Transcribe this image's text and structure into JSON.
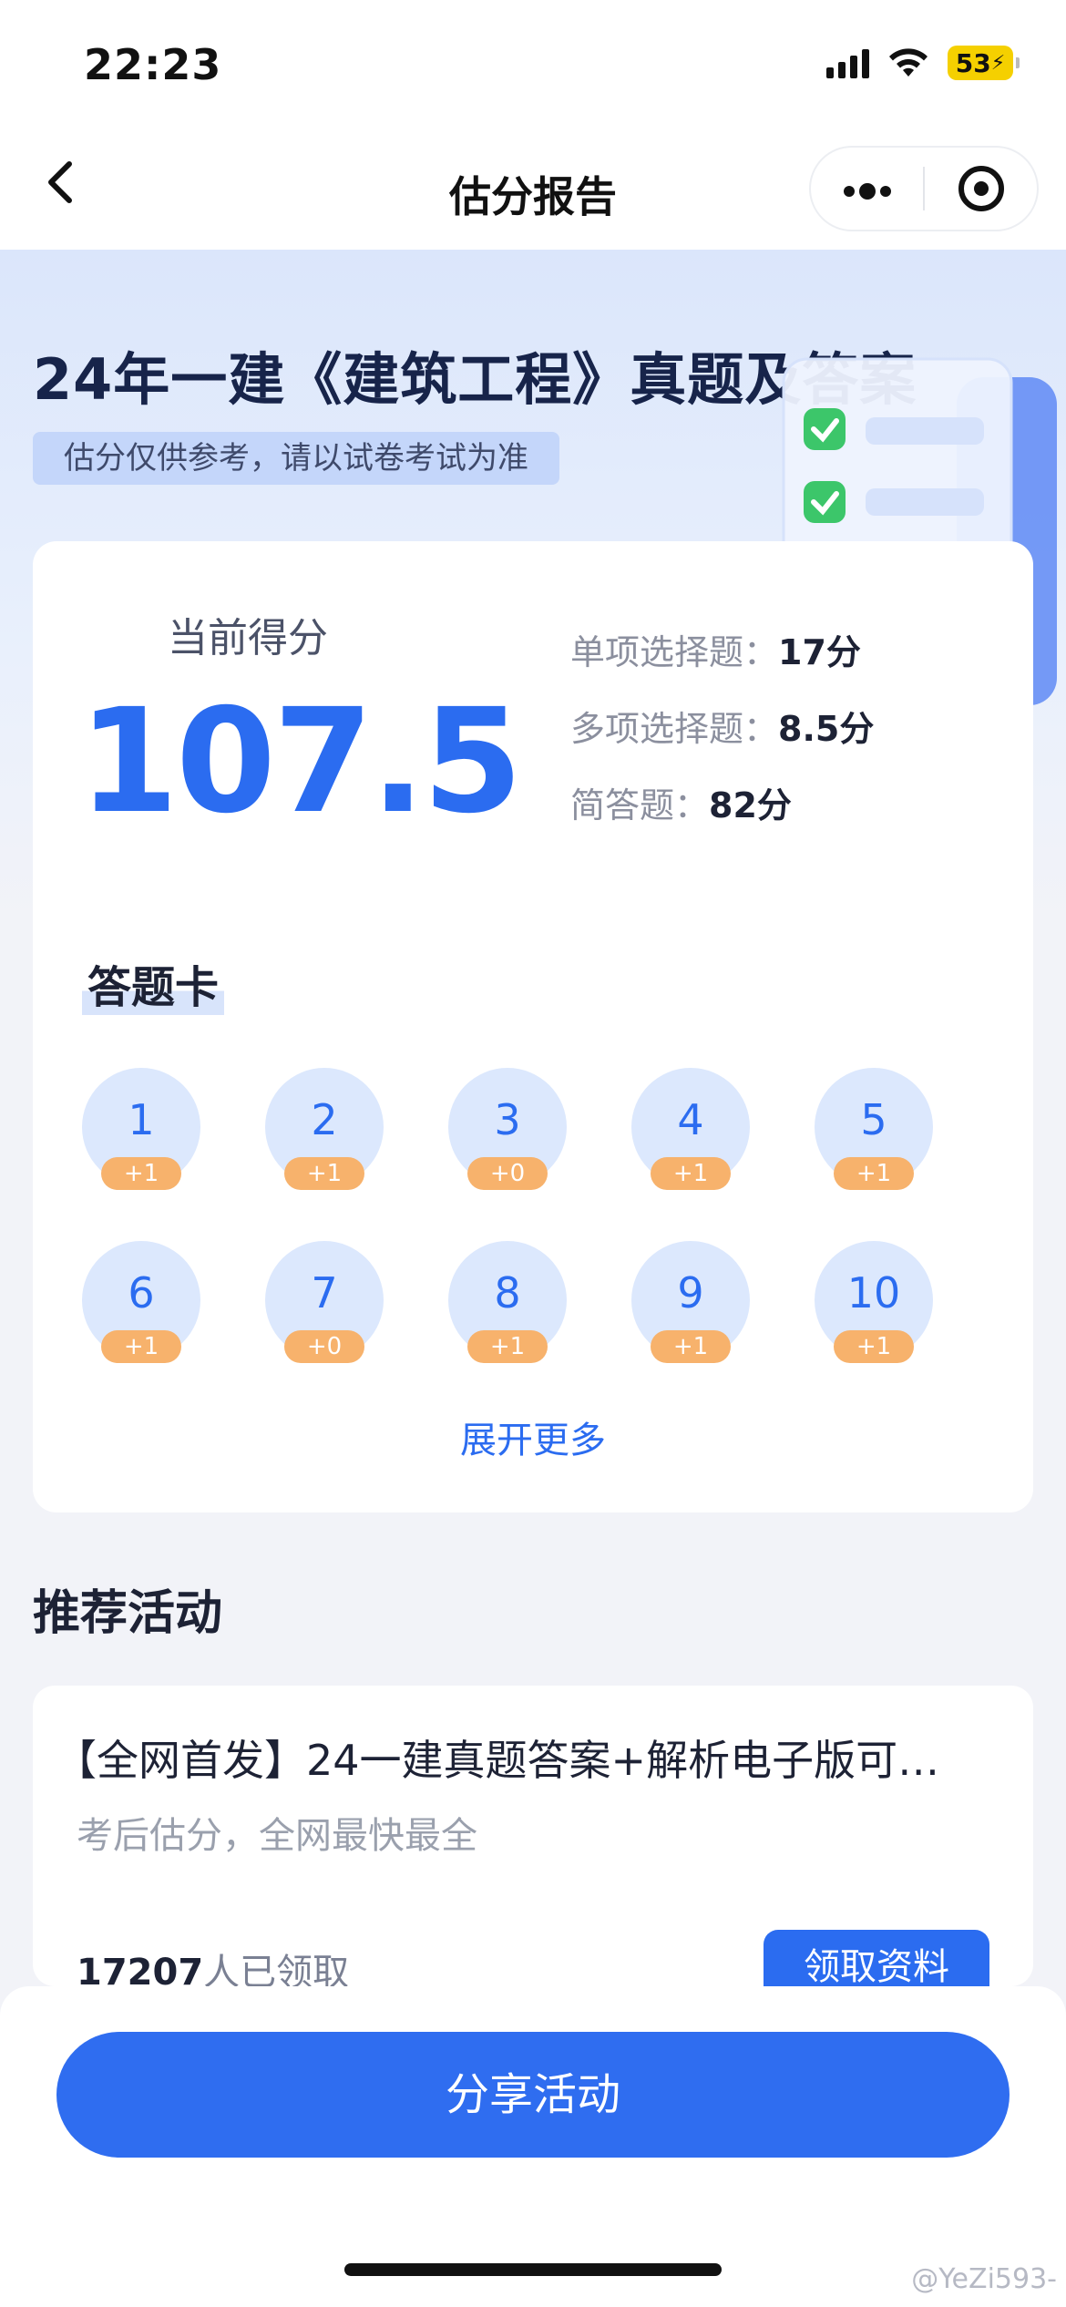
{
  "status_bar": {
    "time": "22:23",
    "battery": "53"
  },
  "nav": {
    "title": "估分报告",
    "back_icon": "chevron-left-icon",
    "more_label": "•••"
  },
  "hero": {
    "title": "24年一建《建筑工程》真题及答案",
    "tag": "估分仅供参考，请以试卷考试为准"
  },
  "score": {
    "label": "当前得分",
    "value": "107.5",
    "breakdown": [
      {
        "label": "单项选择题：",
        "value": "17分"
      },
      {
        "label": "多项选择题：",
        "value": "8.5分"
      },
      {
        "label": "简答题：",
        "value": "82分"
      }
    ]
  },
  "answer_sheet": {
    "title": "答题卡",
    "items": [
      {
        "num": "1",
        "points": "+1"
      },
      {
        "num": "2",
        "points": "+1"
      },
      {
        "num": "3",
        "points": "+0"
      },
      {
        "num": "4",
        "points": "+1"
      },
      {
        "num": "5",
        "points": "+1"
      },
      {
        "num": "6",
        "points": "+1"
      },
      {
        "num": "7",
        "points": "+0"
      },
      {
        "num": "8",
        "points": "+1"
      },
      {
        "num": "9",
        "points": "+1"
      },
      {
        "num": "10",
        "points": "+1"
      }
    ],
    "expand_label": "展开更多"
  },
  "recommended": {
    "section_title": "推荐活动",
    "card_title": "【全网首发】24一建真题答案+解析电子版可…",
    "card_subtitle": "考后估分，全网最快最全",
    "count_number": "17207",
    "count_suffix": "人已领取",
    "button_label": "领取资料"
  },
  "bottom": {
    "share_label": "分享活动"
  },
  "watermark": "@YeZi593-",
  "colors": {
    "accent": "#2b6cf0",
    "badge": "#f7b26c",
    "circle": "#dce8fd"
  }
}
